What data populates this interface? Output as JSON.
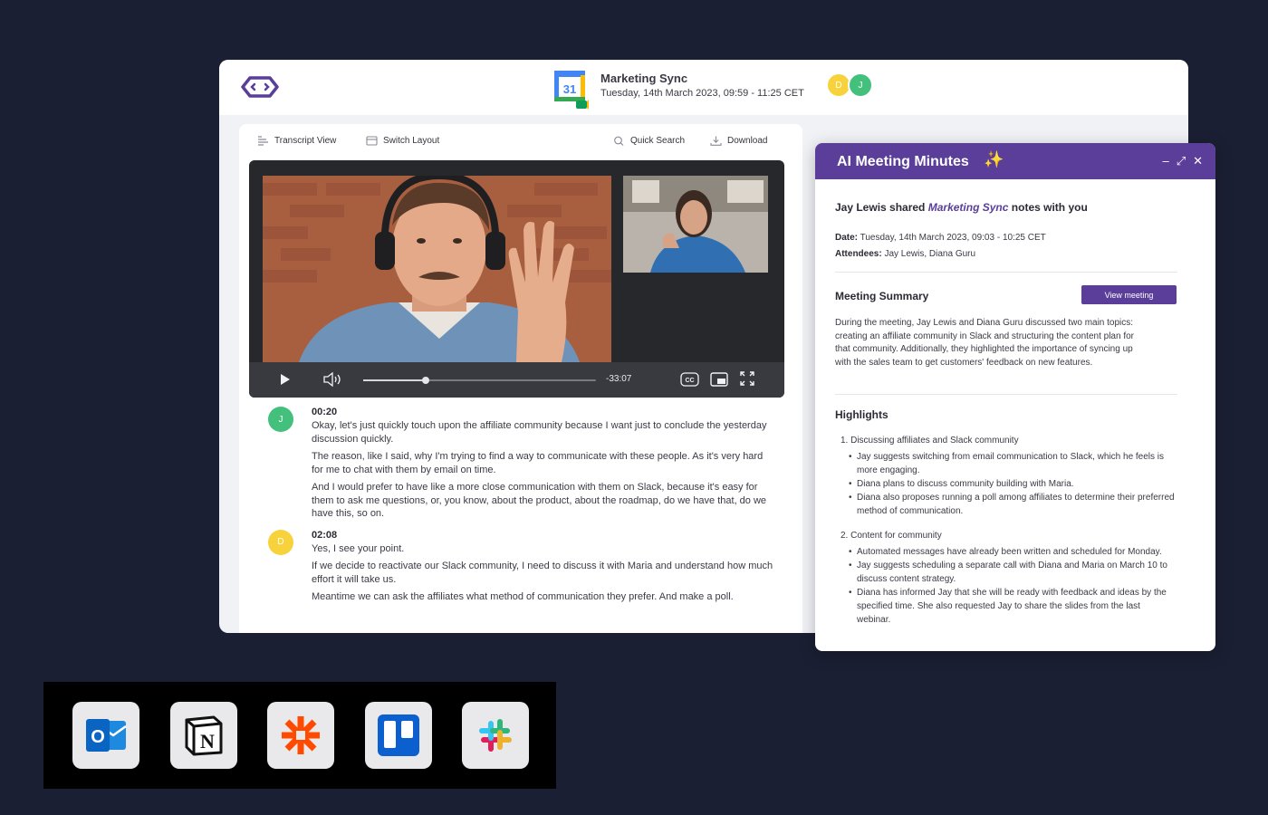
{
  "meeting": {
    "title": "Marketing Sync",
    "date": "Tuesday, 14th March 2023, 09:59 - 11:25 CET",
    "calendar_day": "31",
    "participants": [
      "D",
      "J"
    ]
  },
  "toolbar": {
    "transcript_view": "Transcript View",
    "switch_layout": "Switch Layout",
    "quick_search": "Quick Search",
    "download": "Download"
  },
  "player": {
    "time_remaining": "-33:07",
    "progress": 0.27
  },
  "transcript": [
    {
      "speaker_initial": "J",
      "time": "00:20",
      "paragraphs": [
        "Okay, let's just quickly touch upon the affiliate community because I want just to conclude the yesterday discussion quickly.",
        "The reason, like I said, why I'm trying to find a way to communicate with these people. As it's very hard for me to chat with them by email on time.",
        "And I would prefer to have like a more close communication with them on Slack, because it's easy for them to ask me questions, or, you know, about the product, about the roadmap, do we have that, do we have this, so on."
      ]
    },
    {
      "speaker_initial": "D",
      "time": "02:08",
      "paragraphs": [
        "Yes, I see your point.",
        "If we decide to reactivate our Slack community, I need to discuss it with Maria and understand how much effort it will take us.",
        "Meantime we can ask the affiliates what method of communication they prefer. And make a poll."
      ]
    }
  ],
  "panel": {
    "title": "AI Meeting Minutes",
    "shared_prefix": "Jay Lewis shared",
    "shared_meeting": "Marketing Sync",
    "shared_suffix": "notes with you",
    "date_label": "Date:",
    "date_value": "Tuesday, 14th March 2023, 09:03 - 10:25 CET",
    "attendees_label": "Attendees:",
    "attendees_value": "Jay Lewis, Diana Guru",
    "summary_title": "Meeting Summary",
    "view_button": "View meeting",
    "summary": "During the meeting, Jay Lewis and Diana Guru discussed two main topics: creating an affiliate community in Slack and structuring the content plan for that community. Additionally, they highlighted the importance of syncing up with the sales team to get customers' feedback on new features.",
    "highlights_title": "Highlights",
    "highlights": [
      {
        "title": "1. Discussing affiliates and Slack community",
        "points": [
          "Jay suggests switching from email communication to Slack, which he feels is more engaging.",
          "Diana plans to discuss community building with Maria.",
          "Diana also proposes running a poll among affiliates to determine their preferred method of communication."
        ]
      },
      {
        "title": "2. Content for community",
        "points": [
          "Automated messages have already been written and scheduled for Monday.",
          "Jay suggests scheduling a separate call with Diana and Maria on March 10 to discuss content strategy.",
          "Diana has informed Jay that she will be ready with feedback and ideas by the specified time. She also requested Jay to share the slides from the last webinar."
        ]
      }
    ]
  },
  "integrations": [
    "outlook-icon",
    "notion-icon",
    "zapier-icon",
    "trello-icon",
    "slack-icon"
  ],
  "colors": {
    "background": "#1b1f33",
    "brand_purple": "#5a3e9a",
    "avatar_yellow": "#f7d23a",
    "avatar_green": "#42c07c"
  }
}
